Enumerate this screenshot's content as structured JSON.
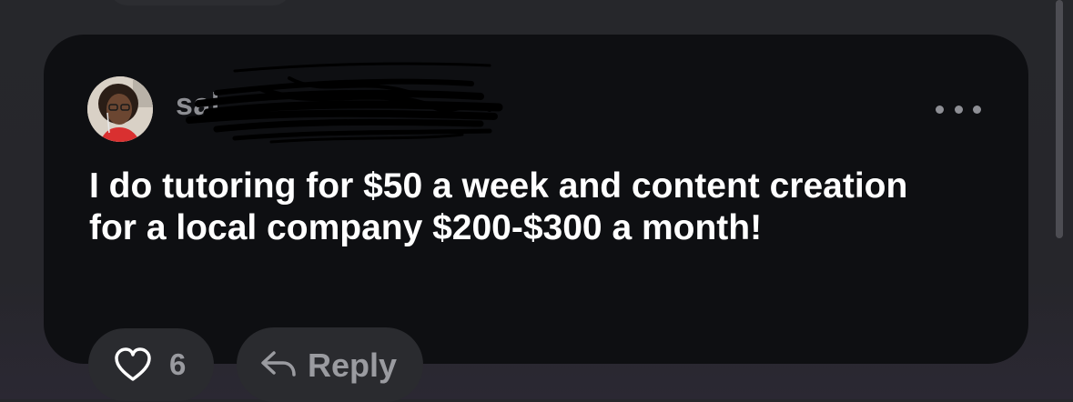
{
  "comment": {
    "username": "sal",
    "text": "I do tutoring for $50 a week and content creation for a local company $200-$300 a month!",
    "like_count": "6",
    "reply_label": "Reply"
  },
  "icons": {
    "more": "more-options-icon",
    "like": "heart-icon",
    "reply": "reply-arrow-icon"
  },
  "colors": {
    "card_background": "#0e0f12",
    "page_background": "#26272b",
    "pill_background": "#2a2b2f",
    "text_primary": "#ffffff",
    "text_muted": "#9a9ba0"
  }
}
